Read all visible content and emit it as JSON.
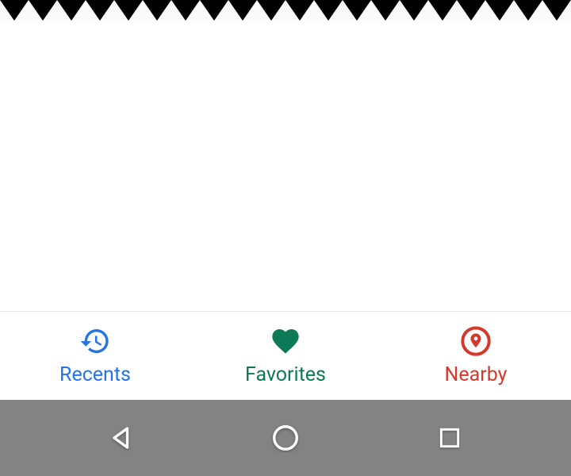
{
  "bottomNav": {
    "items": [
      {
        "id": "recents",
        "label": "Recents",
        "color": "#2573e8"
      },
      {
        "id": "favorites",
        "label": "Favorites",
        "color": "#0c7a56"
      },
      {
        "id": "nearby",
        "label": "Nearby",
        "color": "#d43a2c"
      }
    ],
    "selected": "favorites"
  },
  "systemNav": {
    "buttons": [
      "back",
      "home",
      "overview"
    ]
  }
}
